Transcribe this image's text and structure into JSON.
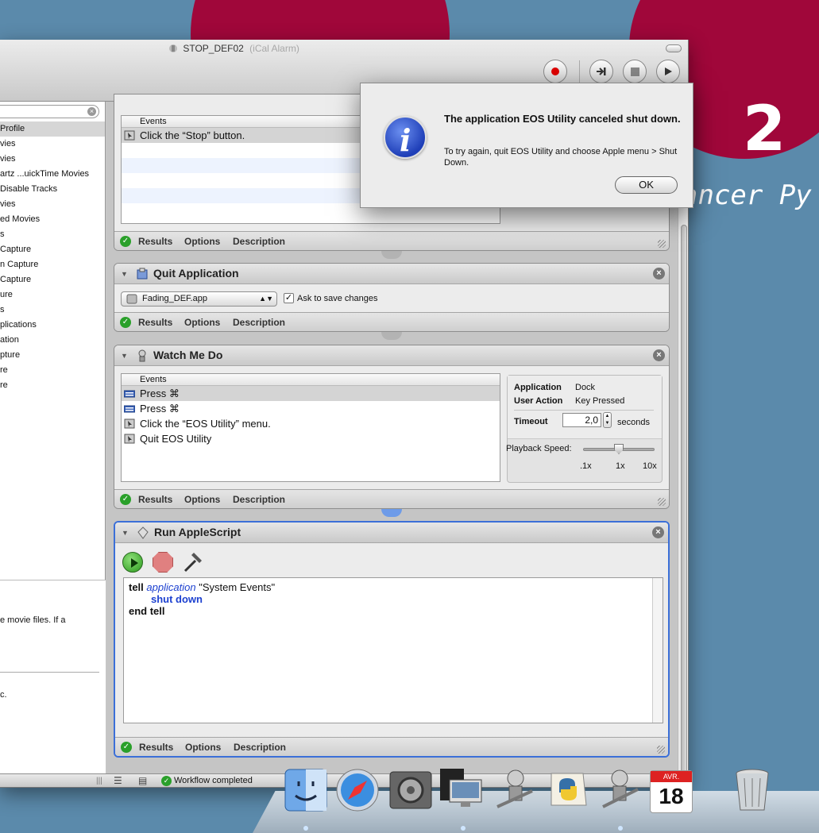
{
  "desktop": {
    "number": "2",
    "text": "ancer Py"
  },
  "window": {
    "title": "STOP_DEF02",
    "subtitle": "(iCal Alarm)"
  },
  "library": {
    "items": [
      "Profile",
      "vies",
      "vies",
      "artz ...uickTime Movies",
      "Disable Tracks",
      "vies",
      "ed Movies",
      "s",
      " Capture",
      "n Capture",
      " Capture",
      "ure",
      "s",
      "plications",
      "ation",
      "pture",
      "re",
      "re"
    ],
    "description": "e movie files. If a",
    "copyright": "c."
  },
  "actions": {
    "first": {
      "events_header": "Events",
      "rows": [
        "Click the “Stop” button."
      ]
    },
    "quit": {
      "title": "Quit Application",
      "app": "Fading_DEF.app",
      "checkbox_label": "Ask to save changes",
      "checked": true
    },
    "watch": {
      "title": "Watch Me Do",
      "events_header": "Events",
      "rows": [
        "Press ⌘",
        "Press ⌘",
        "Click the “EOS Utility” menu.",
        "Quit EOS Utility"
      ],
      "application_label": "Application",
      "application_value": "Dock",
      "user_action_label": "User Action",
      "user_action_value": "Key Pressed",
      "timeout_label": "Timeout",
      "timeout_value": "2,0",
      "timeout_unit": "seconds",
      "playback_label": "Playback Speed:",
      "speed_ticks": [
        ".1x",
        "1x",
        "10x"
      ]
    },
    "script": {
      "title": "Run AppleScript",
      "line1_kw": "tell",
      "line1_app": "application",
      "line1_str": "\"System Events\"",
      "line2": "shut down",
      "line3": "end tell"
    }
  },
  "footer": {
    "results": "Results",
    "options": "Options",
    "description": "Description"
  },
  "status": {
    "text": "Workflow completed"
  },
  "alert": {
    "title": "The application EOS Utility canceled shut down.",
    "message": "To try again, quit EOS Utility and choose Apple menu > Shut Down.",
    "ok": "OK"
  },
  "dock": {
    "calendar_month": "AVR.",
    "calendar_day": "18"
  },
  "colors": {
    "desktop": "#5b8aab",
    "desktop_accent": "#a0073a",
    "selection": "#3b6fd8",
    "success": "#2aa02a",
    "record": "#e00000"
  }
}
